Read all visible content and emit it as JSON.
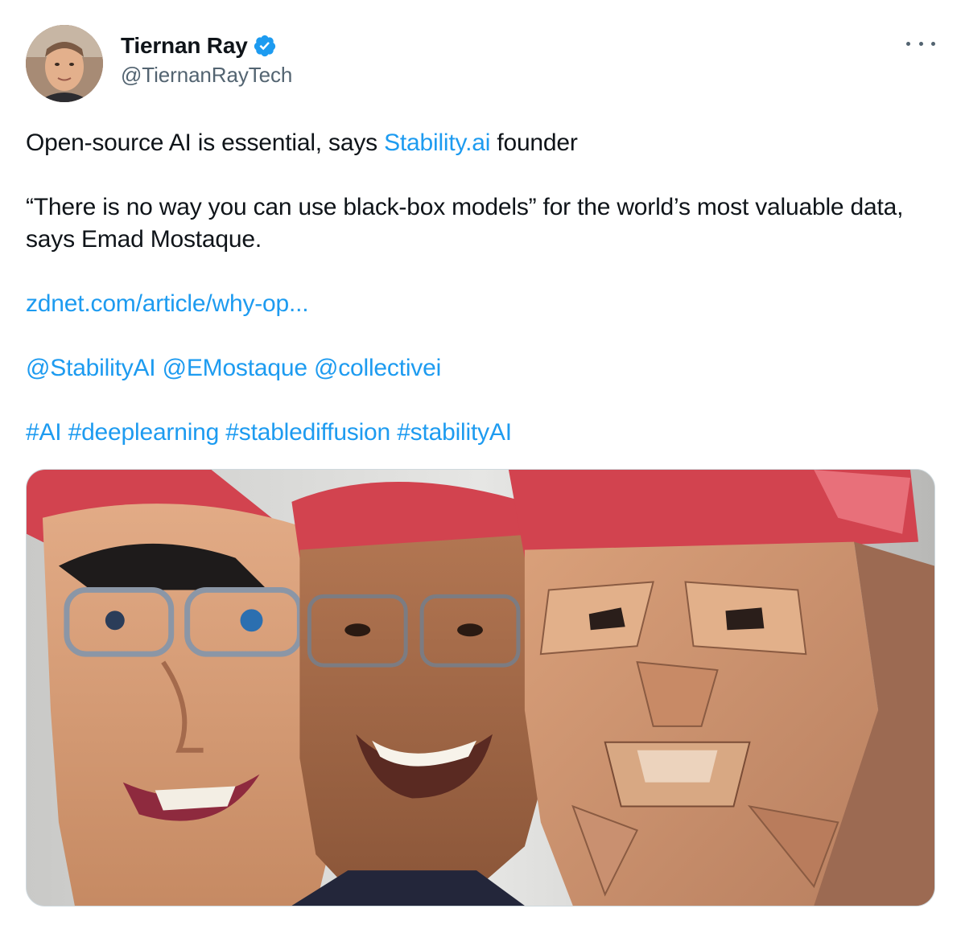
{
  "author": {
    "display_name": "Tiernan Ray",
    "handle": "@TiernanRayTech"
  },
  "tweet": {
    "line1_prefix": "Open-source AI is essential, says ",
    "line1_link": "Stability.ai",
    "line1_suffix": " founder",
    "quote": "“There is no way you can use black-box models” for the world’s most valuable data, says Emad Mostaque.",
    "url": "zdnet.com/article/why-op...",
    "mentions": [
      "@StabilityAI",
      "@EMostaque",
      "@collectivei"
    ],
    "hashtags": [
      "#AI",
      "#deeplearning",
      "#stablediffusion",
      "#stabilityAI"
    ]
  },
  "colors": {
    "link": "#1d9bf0",
    "text": "#0f1419",
    "secondary": "#536471",
    "verified": "#1d9bf0"
  },
  "icons": {
    "verified": "verified-badge-icon",
    "more": "more-options-icon"
  }
}
